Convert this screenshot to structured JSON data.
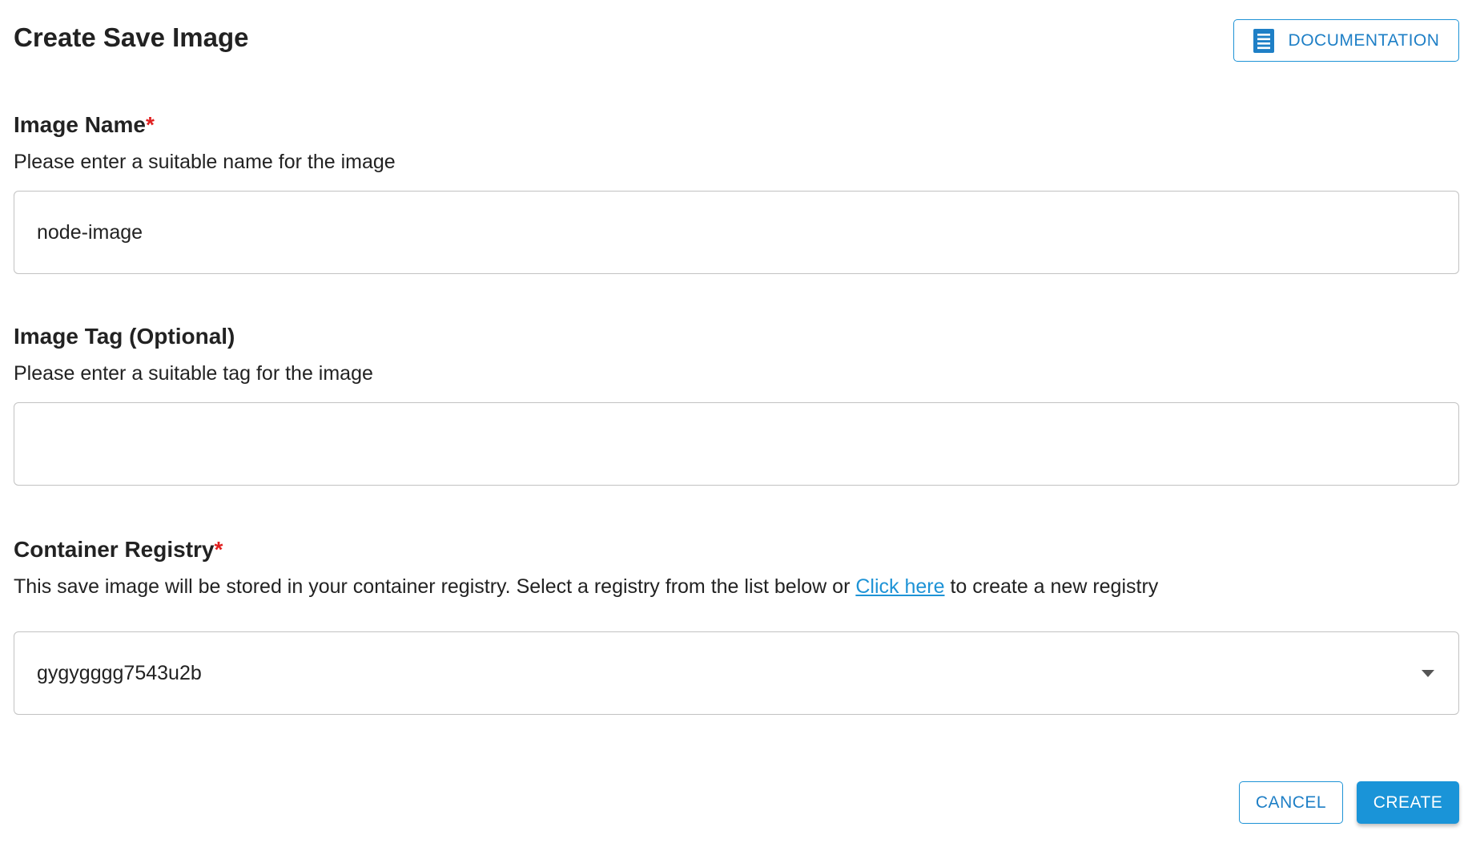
{
  "header": {
    "title": "Create Save Image",
    "documentation_label": "DOCUMENTATION",
    "documentation_icon": "document-icon"
  },
  "image_name": {
    "label": "Image Name",
    "required_mark": "*",
    "help": "Please enter a suitable name for the image",
    "value": "node-image"
  },
  "image_tag": {
    "label": "Image Tag (Optional)",
    "help": "Please enter a suitable tag for the image",
    "value": ""
  },
  "registry": {
    "label": "Container Registry",
    "required_mark": "*",
    "help_before": "This save image will be stored in your container registry. Select a registry from the list below or ",
    "help_link": "Click here",
    "help_after": " to create a new registry",
    "selected": "gygygggg7543u2b",
    "dropdown_icon": "caret-down-icon"
  },
  "actions": {
    "cancel_label": "CANCEL",
    "create_label": "CREATE"
  },
  "colors": {
    "accent": "#1a94d8",
    "required": "#e02020",
    "border": "#c2c2c2"
  }
}
